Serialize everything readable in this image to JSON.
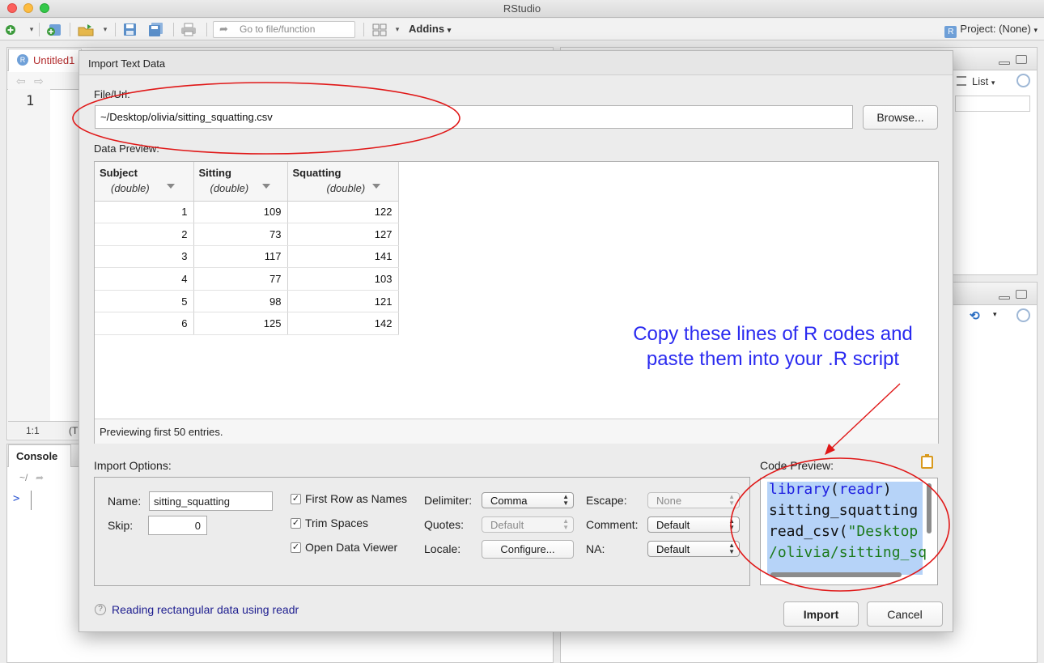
{
  "window": {
    "title": "RStudio"
  },
  "toolbar": {
    "goto_placeholder": "Go to file/function",
    "addins_label": "Addins",
    "project_label": "Project: (None)"
  },
  "editor": {
    "tab_title": "Untitled1",
    "line_number": "1",
    "cursor_pos": "1:1",
    "file_type_stub": "(T"
  },
  "console": {
    "tab_label": "Console",
    "path": "~/",
    "prompt": ">"
  },
  "env_pane": {
    "list_label": "List"
  },
  "dialog": {
    "title": "Import Text Data",
    "file_label": "File/Url:",
    "file_value": "~/Desktop/olivia/sitting_squatting.csv",
    "browse_label": "Browse...",
    "data_preview_label": "Data Preview:",
    "columns": [
      {
        "name": "Subject",
        "type": "(double)"
      },
      {
        "name": "Sitting",
        "type": "(double)"
      },
      {
        "name": "Squatting",
        "type": "(double)"
      }
    ],
    "rows": [
      [
        "1",
        "109",
        "122"
      ],
      [
        "2",
        "73",
        "127"
      ],
      [
        "3",
        "117",
        "141"
      ],
      [
        "4",
        "77",
        "103"
      ],
      [
        "5",
        "98",
        "121"
      ],
      [
        "6",
        "125",
        "142"
      ]
    ],
    "preview_footer": "Previewing first 50 entries.",
    "import_options_label": "Import Options:",
    "name_label": "Name:",
    "name_value": "sitting_squatting",
    "skip_label": "Skip:",
    "skip_value": "0",
    "first_row_label": "First Row as Names",
    "trim_spaces_label": "Trim Spaces",
    "open_viewer_label": "Open Data Viewer",
    "first_row_checked": true,
    "trim_spaces_checked": true,
    "open_viewer_checked": true,
    "delimiter_label": "Delimiter:",
    "delimiter_value": "Comma",
    "quotes_label": "Quotes:",
    "quotes_value": "Default",
    "locale_label": "Locale:",
    "locale_button": "Configure...",
    "escape_label": "Escape:",
    "escape_value": "None",
    "comment_label": "Comment:",
    "comment_value": "Default",
    "na_label": "NA:",
    "na_value": "Default",
    "code_preview_label": "Code Preview:",
    "code_lines": [
      {
        "a": "library",
        "b": "(",
        "c": "readr",
        "d": ")"
      },
      {
        "a": "sitting_squatting"
      },
      {
        "a": "read_csv",
        "b": "(",
        "c": "\"Desktop"
      },
      {
        "c": "/olivia/sitting_sq"
      }
    ],
    "help_link": "Reading rectangular data using readr",
    "import_button": "Import",
    "cancel_button": "Cancel"
  },
  "annotation": {
    "line1": "Copy these lines of R codes and",
    "line2": "paste them into your .R script",
    "color": "#2a2af0",
    "ellipse_color": "#e01818"
  }
}
